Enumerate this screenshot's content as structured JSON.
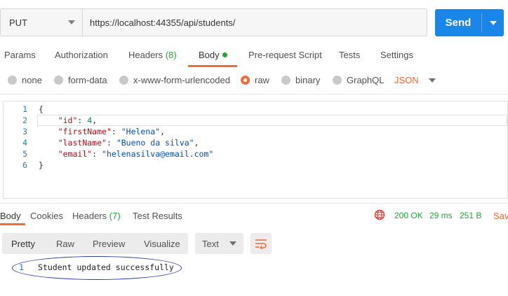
{
  "request": {
    "method": "PUT",
    "url": "https://localhost:44355/api/students/",
    "send_label": "Send"
  },
  "request_tabs": {
    "params": "Params",
    "authorization": "Authorization",
    "headers": "Headers",
    "headers_count": "(8)",
    "body": "Body",
    "pre_request": "Pre-request Script",
    "tests": "Tests",
    "settings": "Settings"
  },
  "body_types": {
    "none": "none",
    "form_data": "form-data",
    "urlencoded": "x-www-form-urlencoded",
    "raw": "raw",
    "binary": "binary",
    "graphql": "GraphQL",
    "format": "JSON",
    "selected": "raw"
  },
  "editor": {
    "line_numbers": [
      "1",
      "2",
      "3",
      "4",
      "5",
      "6"
    ],
    "open_brace": "{",
    "close_brace": "}",
    "fields": [
      {
        "key": "\"id\"",
        "value": "4",
        "suffix": ","
      },
      {
        "key": "\"firstName\"",
        "value": "\"Helena\"",
        "suffix": ","
      },
      {
        "key": "\"lastName\"",
        "value": "\"Bueno da silva\"",
        "suffix": ","
      },
      {
        "key": "\"email\"",
        "value": "\"helenasilva@email.com\"",
        "suffix": ""
      }
    ]
  },
  "response_tabs": {
    "body": "Body",
    "cookies": "Cookies",
    "headers": "Headers",
    "headers_count": "(7)",
    "test_results": "Test Results"
  },
  "response_status": {
    "status": "200 OK",
    "time": "29 ms",
    "size": "251 B",
    "save": "Save"
  },
  "response_toolbar": {
    "pretty": "Pretty",
    "raw": "Raw",
    "preview": "Preview",
    "visualize": "Visualize",
    "format": "Text"
  },
  "response_body": {
    "line_number": "1",
    "text": "Student updated successfully"
  },
  "colors": {
    "accent": "#f26b3a",
    "send": "#1a86e8",
    "success": "#21a537"
  }
}
